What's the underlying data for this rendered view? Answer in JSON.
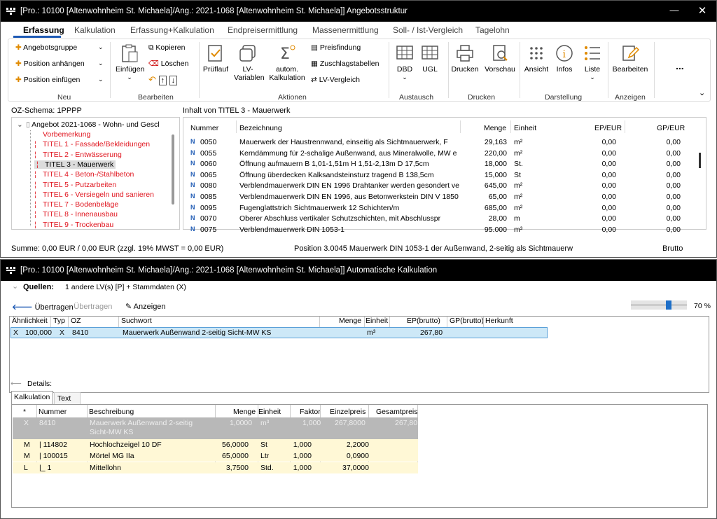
{
  "window1": {
    "title": "[Pro.: 10100 [Altenwohnheim St. Michaela]/Ang.: 2021-1068 [Altenwohnheim St. Michaela]] Angebotsstruktur",
    "tabs": [
      "Erfassung",
      "Kalkulation",
      "Erfassung+Kalkulation",
      "Endpreisermittlung",
      "Massenermittlung",
      "Soll- / Ist-Vergleich",
      "Tagelohn"
    ],
    "ribbon": {
      "neu": {
        "label": "Neu",
        "items": [
          "Angebotsgruppe",
          "Position anhängen",
          "Position einfügen"
        ]
      },
      "bearbeiten": {
        "label": "Bearbeiten",
        "einfuegen": "Einfügen",
        "kopieren": "Kopieren",
        "loeschen": "Löschen"
      },
      "aktionen": {
        "label": "Aktionen",
        "pruflauf": "Prüflauf",
        "lv_variablen_1": "LV-",
        "lv_variablen_2": "Variablen",
        "autom_1": "autom.",
        "autom_2": "Kalkulation",
        "preisfindung": "Preisfindung",
        "zuschlag": "Zuschlagstabellen",
        "lvvergleich": "LV-Vergleich"
      },
      "austausch": {
        "label": "Austausch",
        "dbd": "DBD",
        "ugl": "UGL"
      },
      "drucken": {
        "label": "Drucken",
        "drucken": "Drucken",
        "vorschau": "Vorschau"
      },
      "darstellung": {
        "label": "Darstellung",
        "ansicht": "Ansicht",
        "infos": "Infos",
        "liste": "Liste"
      },
      "anzeigen": {
        "label": "Anzeigen",
        "bearbeiten": "Bearbeiten"
      },
      "more": "..."
    },
    "oz_schema": "OZ-Schema: 1PPPP",
    "inhalt": "Inhalt von TITEL 3 - Mauerwerk",
    "tree": {
      "root": "Angebot 2021-1068 - Wohn- und Gescl",
      "items": [
        {
          "label": "Vorbemerkung",
          "red": true
        },
        {
          "label": "TITEL 1 - Fassade/Bekleidungen",
          "red": true
        },
        {
          "label": "TITEL 2 - Entwässerung",
          "red": true
        },
        {
          "label": "TITEL 3 - Mauerwerk",
          "red": false
        },
        {
          "label": "TITEL 4 - Beton-/Stahlbeton",
          "red": true
        },
        {
          "label": "TITEL 5 - Putzarbeiten",
          "red": true
        },
        {
          "label": "TITEL 6 - Versiegeln und sanieren",
          "red": true
        },
        {
          "label": "TITEL 7 - Bodenbeläge",
          "red": true
        },
        {
          "label": "TITEL 8 - Innenausbau",
          "red": true
        },
        {
          "label": "TITEL 9 - Trockenbau",
          "red": true
        }
      ]
    },
    "table": {
      "headers": {
        "nummer": "Nummer",
        "bezeichnung": "Bezeichnung",
        "menge": "Menge",
        "einheit": "Einheit",
        "ep": "EP/EUR",
        "gp": "GP/EUR"
      },
      "rows": [
        {
          "nr": "0050",
          "bez": "Mauerwerk der Haustrennwand, einseitig als Sichtmauerwerk, F",
          "menge": "29,163",
          "einheit": "m²",
          "ep": "0,00",
          "gp": "0,00"
        },
        {
          "nr": "0055",
          "bez": "Kerndämmung für 2-schalige Außenwand, aus Mineralwolle, MW e",
          "menge": "220,00",
          "einheit": "m²",
          "ep": "0,00",
          "gp": "0,00"
        },
        {
          "nr": "0060",
          "bez": "Öffnung aufmauern B 1,01-1,51m H 1,51-2,13m D 17,5cm",
          "menge": "18,000",
          "einheit": "St.",
          "ep": "0,00",
          "gp": "0,00"
        },
        {
          "nr": "0065",
          "bez": "Öffnung überdecken Kalksandsteinsturz tragend B 138,5cm",
          "menge": "15,000",
          "einheit": "St",
          "ep": "0,00",
          "gp": "0,00"
        },
        {
          "nr": "0080",
          "bez": "Verblendmauerwerk DIN EN 1996 Drahtanker werden gesondert ve",
          "menge": "645,00",
          "einheit": "m²",
          "ep": "0,00",
          "gp": "0,00"
        },
        {
          "nr": "0085",
          "bez": "Verblendmauerwerk DIN EN 1996, aus Betonwerkstein DIN V 1850",
          "menge": "65,00",
          "einheit": "m²",
          "ep": "0,00",
          "gp": "0,00"
        },
        {
          "nr": "0095",
          "bez": "Fugenglattstrich Sichtmauerwerk 12 Schichten/m",
          "menge": "685,00",
          "einheit": "m²",
          "ep": "0,00",
          "gp": "0,00"
        },
        {
          "nr": "0070",
          "bez": "Oberer Abschluss vertikaler Schutzschichten, mit Abschlusspr",
          "menge": "28,00",
          "einheit": "m",
          "ep": "0,00",
          "gp": "0,00"
        },
        {
          "nr": "0075",
          "bez": "Verblendmauerwerk DIN 1053-1",
          "menge": "95.000",
          "einheit": "m³",
          "ep": "0,00",
          "gp": "0,00"
        }
      ]
    },
    "status": {
      "summe": "Summe: 0,00 EUR / 0,00 EUR (zzgl. 19% MWST = 0,00 EUR)",
      "position": "Position 3.0045 Mauerwerk DIN 1053-1 der Außenwand, 2-seitig als Sichtmauerw",
      "brutto": "Brutto"
    }
  },
  "window2": {
    "title": "[Pro.: 10100 [Altenwohnheim St. Michaela]/Ang.: 2021-1068 [Altenwohnheim St. Michaela]] Automatische Kalkulation",
    "quellen_label": "Quellen:",
    "quellen_value": "1 andere LV(s) [P] + Stammdaten (X)",
    "toolbar": {
      "uebertragen1": "Übertragen",
      "uebertragen2": "Übertragen",
      "anzeigen": "Anzeigen"
    },
    "zoom": "70 %",
    "zoom_level": 0.7,
    "grid_headers": {
      "aehnlichkeit": "Ähnlichkeit",
      "typ": "Typ",
      "oz": "OZ",
      "suchwort": "Suchwort",
      "menge": "Menge",
      "einheit": "Einheit",
      "ep": "EP(brutto)",
      "gp": "GP(brutto)",
      "herkunft": "Herkunft"
    },
    "grid_row": {
      "x": "X",
      "aehnlichkeit": "100,000",
      "typ": "X",
      "oz": "8410",
      "suchwort": "Mauerwerk Außenwand 2-seitig Sicht-MW KS",
      "einheit": "m³",
      "ep": "267,80"
    },
    "details_label": "Details:",
    "detail_tabs": [
      "Kalkulation",
      "Text"
    ],
    "detail_headers": {
      "star": "*",
      "nummer": "Nummer",
      "beschreibung": "Beschreibung",
      "menge": "Menge",
      "einheit": "Einheit",
      "faktor": "Faktor",
      "einzelpreis": "Einzelpreis",
      "gesamtpreis": "Gesamtpreis"
    },
    "detail_rows": [
      {
        "typ": "X",
        "nummer": "8410",
        "beschreibung": "Mauerwerk Außenwand 2-seitig",
        "beschreibung2": "Sicht-MW KS",
        "menge": "1,0000",
        "einheit": "m³",
        "faktor": "1,000",
        "einzelpreis": "267,8000",
        "gesamtpreis": "267,80"
      },
      {
        "typ": "M",
        "nummer": "|  114802",
        "beschreibung": "Hochlochzeigel 10 DF",
        "menge": "56,0000",
        "einheit": "St",
        "faktor": "1,000",
        "einzelpreis": "2,2000",
        "gesamtpreis": ""
      },
      {
        "typ": "M",
        "nummer": "|  100015",
        "beschreibung": "Mörtel MG IIa",
        "menge": "65,0000",
        "einheit": "Ltr",
        "faktor": "1,000",
        "einzelpreis": "0,0900",
        "gesamtpreis": ""
      },
      {
        "typ": "L",
        "nummer": "|_ 1",
        "beschreibung": "Mittellohn",
        "menge": "3,7500",
        "einheit": "Std.",
        "faktor": "1,000",
        "einzelpreis": "37,0000",
        "gesamtpreis": ""
      }
    ]
  }
}
